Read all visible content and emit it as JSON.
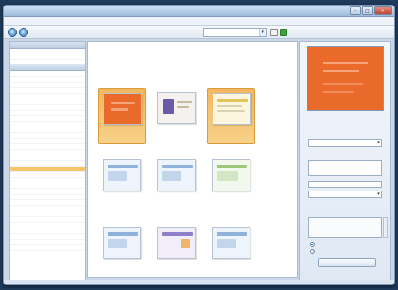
{
  "window": {
    "title": ""
  },
  "menubar": {
    "items": [
      "",
      "",
      "",
      "",
      "",
      "",
      "",
      "",
      "",
      "",
      ""
    ]
  },
  "toolbar": {
    "label": "",
    "filter_value": ""
  },
  "sidebar": {
    "section_top": "",
    "top_items": [
      "",
      ""
    ],
    "section_main": "",
    "items": [
      "",
      "",
      "",
      "",
      "",
      "",
      "",
      "",
      "",
      "",
      "",
      "",
      "",
      "",
      "",
      "",
      "",
      "",
      "",
      "",
      "",
      "",
      "",
      "",
      "",
      "",
      "",
      "",
      "",
      "",
      "",
      "",
      ""
    ],
    "active_index": 17
  },
  "content": {
    "title": "",
    "subtitle": "",
    "breadcrumb": "",
    "templates": [
      {
        "label": "",
        "selected": true,
        "style": "orange"
      },
      {
        "label": "",
        "selected": false,
        "style": "photo"
      },
      {
        "label": "",
        "selected": true,
        "style": "cream"
      },
      {
        "label": "",
        "selected": false,
        "style": "blue"
      },
      {
        "label": "",
        "selected": false,
        "style": "blue"
      },
      {
        "label": "",
        "selected": false,
        "style": "green"
      },
      {
        "label": "",
        "selected": false,
        "style": "blue"
      },
      {
        "label": "",
        "selected": false,
        "style": "purple"
      },
      {
        "label": "",
        "selected": false,
        "style": "blue"
      }
    ]
  },
  "right_panel": {
    "preview_caption": "",
    "section_1": "",
    "text_1": "",
    "field_1": "",
    "text_2": "",
    "field_2": "",
    "field_3": "",
    "field_4": "",
    "section_2": "",
    "text_3": "",
    "radio_1": "",
    "radio_2": "",
    "button": ""
  },
  "statusbar": {
    "text": "",
    "actions": [
      "",
      "",
      ""
    ]
  },
  "colors": {
    "accent_orange": "#ea6a2c",
    "selection": "#f7c46b",
    "title_blue": "#3c5a80"
  }
}
